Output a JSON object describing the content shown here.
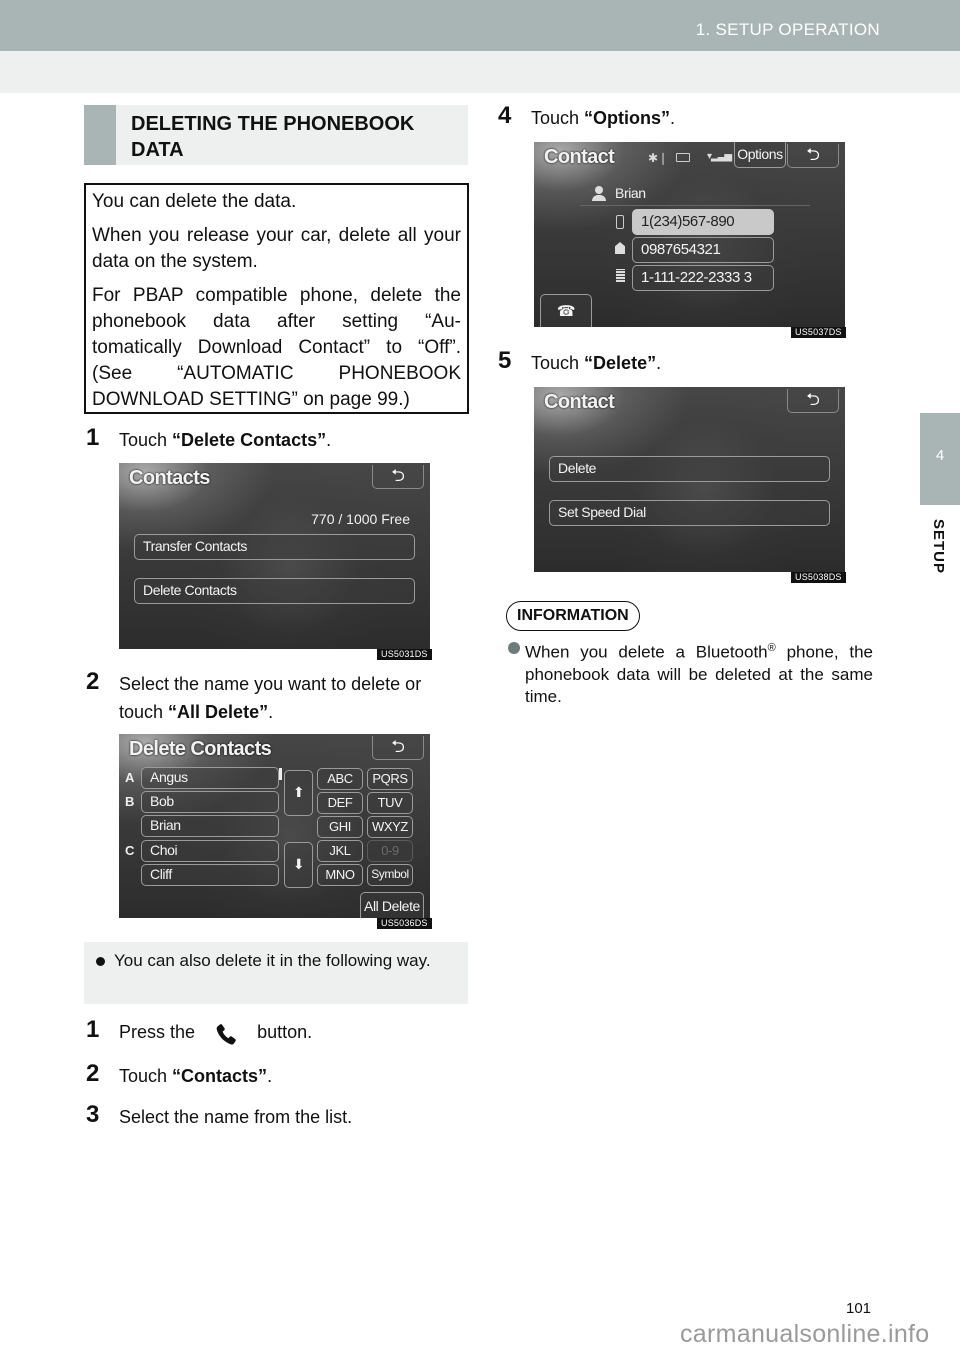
{
  "header": {
    "chapter_title": "1. SETUP OPERATION"
  },
  "side_tab": {
    "number": "4",
    "label": "SETUP"
  },
  "section": {
    "title": "DELETING THE PHONEBOOK DATA"
  },
  "intro_box": {
    "paragraphs": [
      "You can delete the data.",
      "When you release your car, delete all your data on the system.",
      "For PBAP compatible phone, delete the phonebook data after setting “Au-tomatically Download Contact” to “Off”. (See “AUTOMATIC PHONEBOOK DOWNLOAD SETTING” on page 99.)"
    ]
  },
  "steps_main": [
    {
      "num": "1",
      "prefix": "Touch ",
      "bold": "“Delete Contacts”",
      "suffix": "."
    },
    {
      "num": "2",
      "prefix": "Select the name you want to delete or touch ",
      "bold": "“All Delete”",
      "suffix": "."
    },
    {
      "num": "4",
      "prefix": "Touch ",
      "bold": "“Options”",
      "suffix": "."
    },
    {
      "num": "5",
      "prefix": "Touch ",
      "bold": "“Delete”",
      "suffix": "."
    }
  ],
  "note": {
    "text": "You can also delete it in the following way."
  },
  "steps_alt": [
    {
      "num": "1",
      "prefix": "Press the",
      "icon": "phone-icon",
      "suffix": "button."
    },
    {
      "num": "2",
      "prefix": "Touch ",
      "bold": "“Contacts”",
      "suffix": "."
    },
    {
      "num": "3",
      "prefix": "Select the name from the list."
    }
  ],
  "screens": {
    "contacts": {
      "title": "Contacts",
      "back_icon": "⮌",
      "count": "770 / 1000 Free",
      "buttons": [
        "Transfer Contacts",
        "Delete Contacts"
      ],
      "code": "US5031DS"
    },
    "delete_contacts": {
      "title": "Delete Contacts",
      "back_icon": "⮌",
      "index_letters": [
        "A",
        "B",
        "",
        "C",
        ""
      ],
      "names": [
        "Angus",
        "Bob",
        "Brian",
        "Choi",
        "Cliff"
      ],
      "page_up": "⬆",
      "page_down": "⬇",
      "keys": [
        "ABC",
        "PQRS",
        "DEF",
        "TUV",
        "GHI",
        "WXYZ",
        "JKL",
        "0-9",
        "MNO",
        "Symbol"
      ],
      "disabled_key": "0-9",
      "all_delete": "All Delete",
      "code": "US5036DS"
    },
    "contact_detail": {
      "title": "Contact",
      "back_icon": "⮌",
      "options": "Options",
      "name": "Brian",
      "numbers": [
        {
          "type": "mobile",
          "value": "1(234)567-890",
          "selected": true
        },
        {
          "type": "home",
          "value": "0987654321",
          "selected": false
        },
        {
          "type": "office",
          "value": "1-111-222-2333 3",
          "selected": false
        }
      ],
      "code": "US5037DS"
    },
    "contact_options": {
      "title": "Contact",
      "back_icon": "⮌",
      "buttons": [
        "Delete",
        "Set Speed Dial"
      ],
      "code": "US5038DS"
    }
  },
  "information": {
    "badge": "INFORMATION",
    "text_before": "When you delete a Bluetooth",
    "sup": "®",
    "text_after": " phone, the phonebook data will be deleted at the same time."
  },
  "footer": {
    "page_number": "101",
    "watermark": "carmanualsonline.info"
  }
}
